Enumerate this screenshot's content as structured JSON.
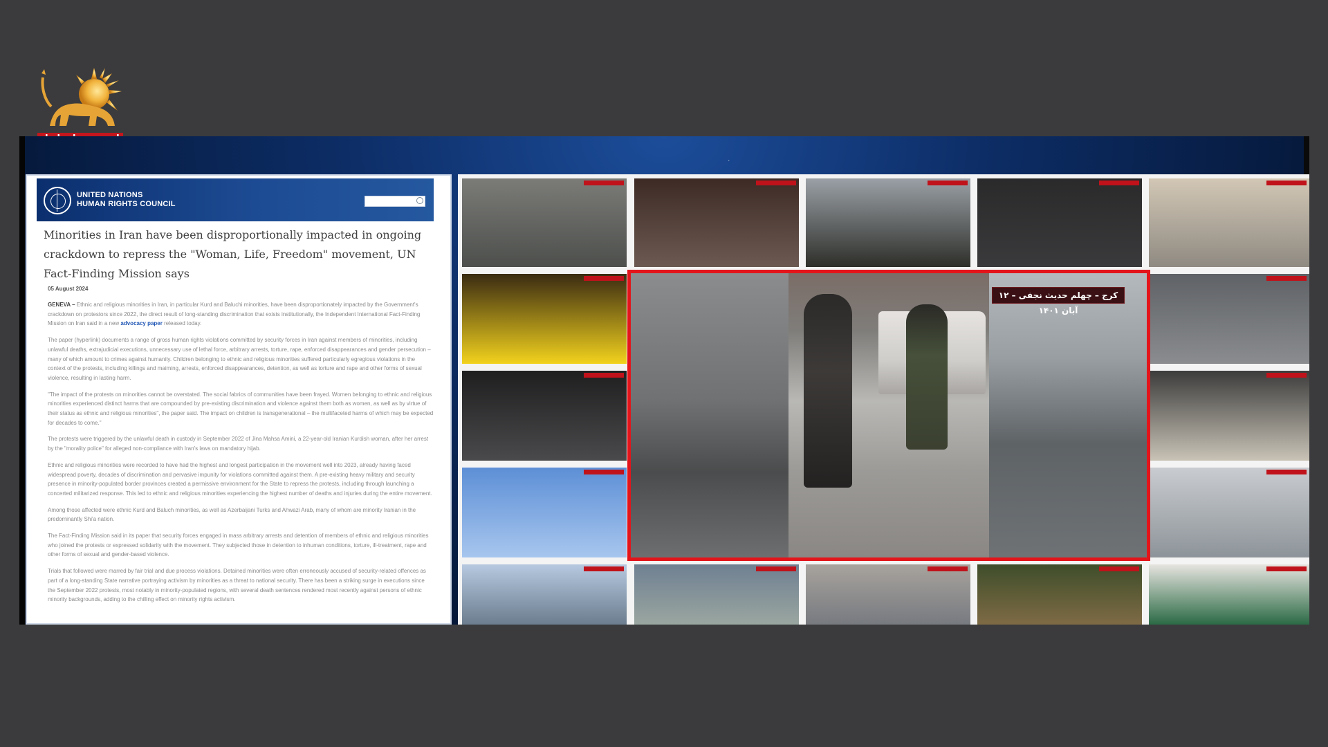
{
  "channel": {
    "name": "تلویزیون ملی ایران",
    "logo_icon": "lion-and-sun-icon",
    "accent_color": "#c4161c"
  },
  "document": {
    "org_line1": "UNITED NATIONS",
    "org_line2": "HUMAN RIGHTS COUNCIL",
    "title": "Minorities in Iran have been disproportionally impacted in ongoing crackdown to repress the \"Woman, Life, Freedom\" movement, UN Fact-Finding Mission says",
    "date": "05 August 2024",
    "paragraphs": [
      {
        "lead": "GENEVA –",
        "text": " Ethnic and religious minorities in Iran, in particular Kurd and Baluchi minorities, have been disproportionately impacted by the Government's crackdown on protestors since 2022, the direct result of long-standing discrimination that exists institutionally, the Independent International Fact-Finding Mission on Iran said in a new ",
        "link": "advocacy paper",
        "tail": " released today."
      },
      {
        "text": "The paper (hyperlink) documents a range of gross human rights violations committed by security forces in Iran against members of minorities, including unlawful deaths, extrajudicial executions, unnecessary use of lethal force, arbitrary arrests, torture, rape, enforced disappearances and gender persecution – many of which amount to crimes against humanity. Children belonging to ethnic and religious minorities suffered particularly egregious violations in the context of the protests, including killings and maiming, arrests, enforced disappearances, detention, as well as torture and rape and other forms of sexual violence, resulting in lasting harm."
      },
      {
        "text": "\"The impact of the protests on minorities cannot be overstated. The social fabrics of communities have been frayed. Women belonging to ethnic and religious minorities experienced distinct harms that are compounded by pre-existing discrimination and violence against them both as women, as well as by virtue of their status as ethnic and religious minorities\", the paper said. The impact on children is transgenerational – the multifaceted harms of which may be expected for decades to come.\""
      },
      {
        "text": "The protests were triggered by the unlawful death in custody in September 2022 of Jina Mahsa Amini, a 22-year-old Iranian Kurdish woman, after her arrest by the \"morality police\" for alleged non-compliance with Iran's laws on mandatory hijab."
      },
      {
        "text": "Ethnic and religious minorities were recorded to have had the highest and longest participation in the movement well into 2023, already having faced widespread poverty, decades of discrimination and pervasive impunity for violations committed against them. A pre-existing heavy military and security presence in minority-populated border provinces created a permissive environment for the State to repress the protests, including through launching a concerted militarized response. This led to ethnic and religious minorities experiencing the highest number of deaths and injuries during the entire movement."
      },
      {
        "text": "Among those affected were ethnic Kurd and Baluch minorities, as well as Azerbaijani Turks and Ahwazi Arab, many of whom are minority Iranian in the predominantly Shi'a nation."
      },
      {
        "text": "The Fact-Finding Mission said in its paper that security forces engaged in mass arbitrary arrests and detention of members of ethnic and religious minorities who joined the protests or expressed solidarity with the movement. They subjected those in detention to inhuman conditions, torture, ill-treatment, rape and other forms of sexual and gender-based violence."
      },
      {
        "text": "Trials that followed were marred by fair trial and due process violations. Detained minorities were often erroneously accused of security-related offences as part of a long-standing State narrative portraying activism by minorities as a threat to national security. There has been a striking surge in executions since the September 2022 protests, most notably in minority-populated regions, with several death sentences rendered most recently against persons of ethnic minority backgrounds, adding to the chilling effect on minority rights activism."
      }
    ]
  },
  "mosaic": {
    "highlight_caption": "کرج – چهلم حدیث نجفی – ۱۲ آبان ۱۴۰۱",
    "highlight_border_color": "#e3151b"
  }
}
